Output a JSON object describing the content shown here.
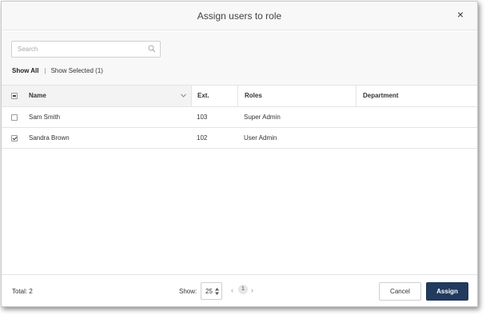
{
  "dialog": {
    "title": "Assign users to role",
    "close_glyph": "×"
  },
  "search": {
    "placeholder": "Search",
    "value": ""
  },
  "filters": {
    "show_all": "Show All",
    "separator": "|",
    "show_selected": "Show Selected (1)"
  },
  "table": {
    "header_checkbox_state": "partial",
    "columns": {
      "name": "Name",
      "ext": "Ext.",
      "roles": "Roles",
      "department": "Department"
    },
    "rows": [
      {
        "checked": false,
        "name": "Sam Smith",
        "ext": "103",
        "roles": "Super Admin",
        "department": ""
      },
      {
        "checked": true,
        "name": "Sandra Brown",
        "ext": "102",
        "roles": "User Admin",
        "department": ""
      }
    ]
  },
  "footer": {
    "total": "Total: 2",
    "show_label": "Show:",
    "page_size": "25",
    "prev_glyph": "‹",
    "current_page": "1",
    "next_glyph": "›",
    "cancel_label": "Cancel",
    "assign_label": "Assign"
  },
  "colors": {
    "primary": "#223a5e",
    "header_bg": "#f8f8f8",
    "border": "#e4e4e4"
  },
  "icons": {
    "search": "search-icon",
    "close": "close-icon",
    "sort": "chevron-down-icon",
    "page_size": "updown-icon"
  }
}
